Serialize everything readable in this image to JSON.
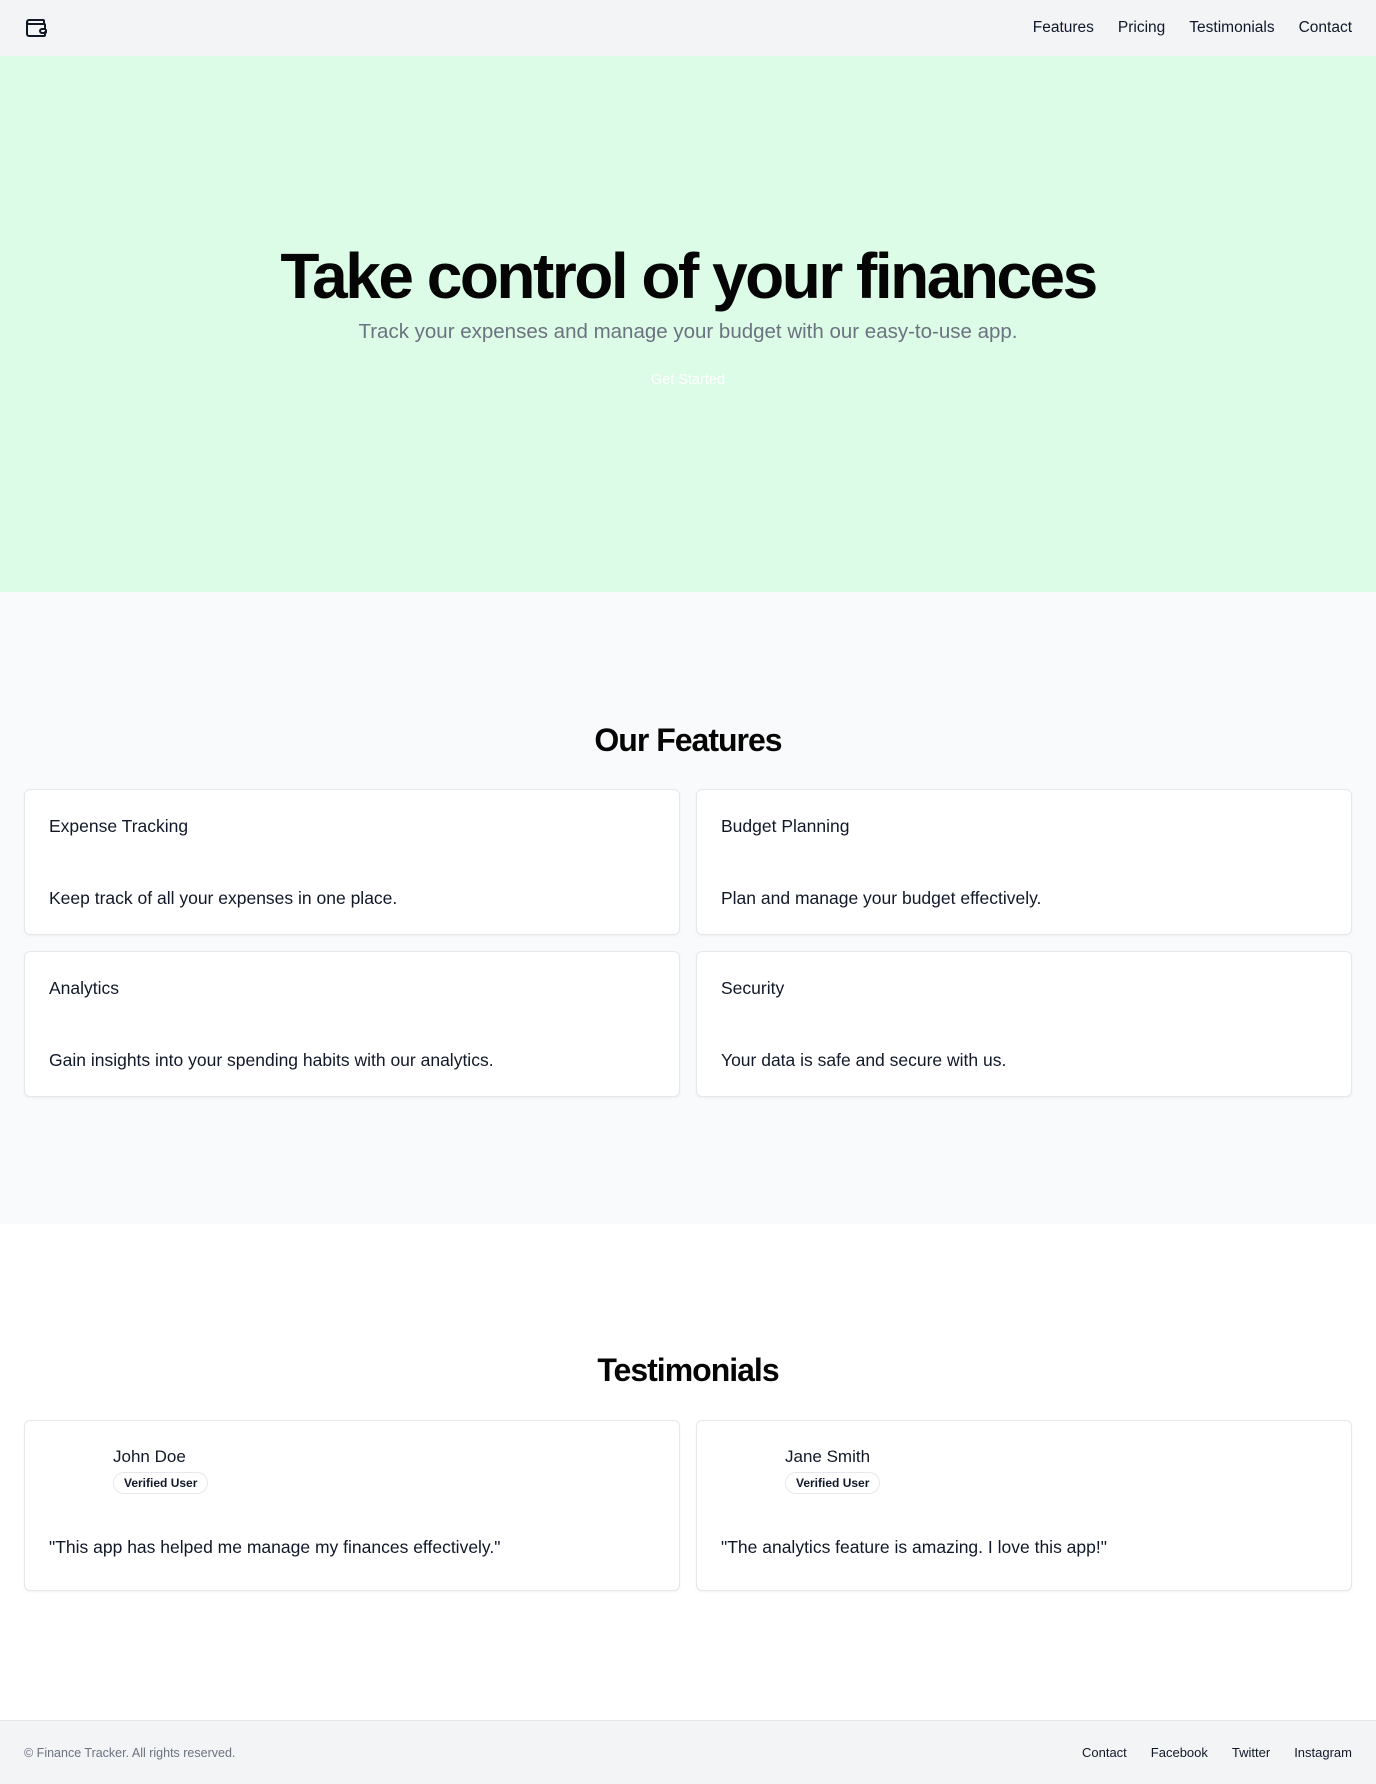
{
  "header": {
    "logo_icon": "wallet-icon",
    "nav": [
      "Features",
      "Pricing",
      "Testimonials",
      "Contact"
    ]
  },
  "hero": {
    "title": "Take control of your finances",
    "subtitle": "Track your expenses and manage your budget with our easy-to-use app.",
    "cta_label": "Get Started",
    "background": "#dcfce7"
  },
  "features": {
    "title": "Our Features",
    "items": [
      {
        "title": "Expense Tracking",
        "description": "Keep track of all your expenses in one place."
      },
      {
        "title": "Budget Planning",
        "description": "Plan and manage your budget effectively."
      },
      {
        "title": "Analytics",
        "description": "Gain insights into your spending habits with our analytics."
      },
      {
        "title": "Security",
        "description": "Your data is safe and secure with us."
      }
    ]
  },
  "testimonials": {
    "title": "Testimonials",
    "items": [
      {
        "name": "John Doe",
        "badge": "Verified User",
        "quote": "\"This app has helped me manage my finances effectively.\""
      },
      {
        "name": "Jane Smith",
        "badge": "Verified User",
        "quote": "\"The analytics feature is amazing. I love this app!\""
      }
    ]
  },
  "footer": {
    "copyright": "© Finance Tracker. All rights reserved.",
    "links": [
      "Contact",
      "Facebook",
      "Twitter",
      "Instagram"
    ]
  }
}
